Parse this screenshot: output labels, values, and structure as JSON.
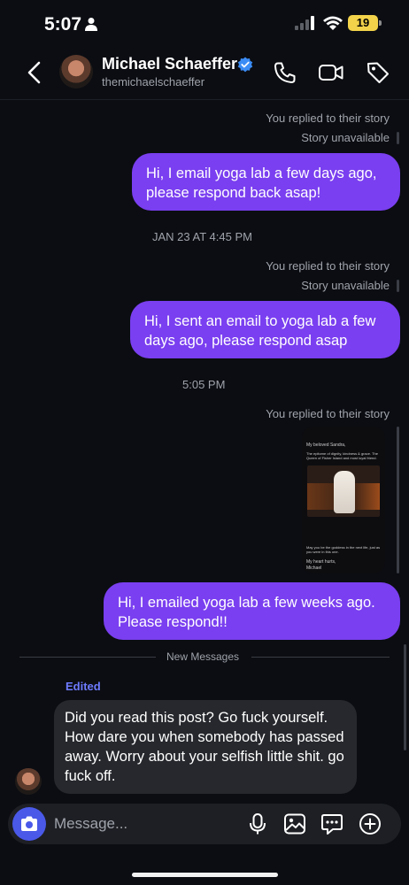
{
  "status_bar": {
    "time": "5:07",
    "battery": "19"
  },
  "header": {
    "name": "Michael Schaeffer",
    "username": "themichaelschaeffer"
  },
  "messages": {
    "meta1_replied": "You replied to their story",
    "meta1_unavail": "Story unavailable",
    "out1": "Hi, I email yoga lab a few days ago, please respond back asap!",
    "stamp1": "JAN 23 AT 4:45 PM",
    "meta2_replied": "You replied to their story",
    "meta2_unavail": "Story unavailable",
    "out2": "Hi, I sent an email to yoga lab a few days ago, please respond asap",
    "stamp2": "5:05 PM",
    "meta3_replied": "You replied to their story",
    "story_card": {
      "line1": "My beloved Sandra,",
      "line2": "The epitome of dignity, kindness & grace. The Queen of Fisher Island and most loyal friend.",
      "line3": "May you be the goddess in the next life, just as you were in this one.",
      "line4": "My heart hurts,",
      "line5": "Michael"
    },
    "out3": "Hi, I emailed yoga lab a few weeks ago. Please respond!!",
    "new_messages": "New Messages",
    "edited": "Edited",
    "in1": "Did you read this post? Go fuck yourself. How dare you when somebody has passed away. Worry about your selfish little shit. go fuck off."
  },
  "composer": {
    "placeholder": "Message..."
  },
  "colors": {
    "outgoing": "#7a3ff0",
    "incoming": "#26282d",
    "accent": "#4a59e8",
    "edited": "#6e7bff"
  },
  "icons": [
    "person-icon",
    "signal-icon",
    "wifi-icon",
    "battery-icon",
    "back-icon",
    "verified-icon",
    "phone-icon",
    "video-icon",
    "tag-icon",
    "camera-icon",
    "mic-icon",
    "image-icon",
    "sticker-icon",
    "plus-icon"
  ]
}
